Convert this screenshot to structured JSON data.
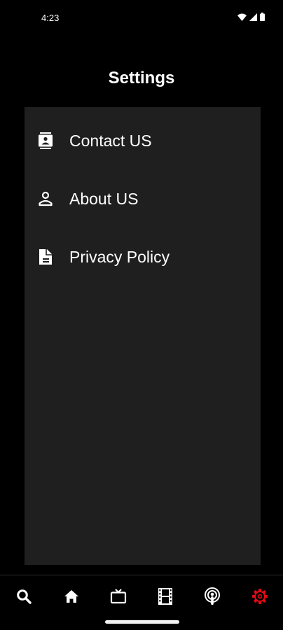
{
  "status_bar": {
    "time": "4:23",
    "icons": [
      "wifi-icon",
      "signal-icon",
      "battery-icon"
    ]
  },
  "header": {
    "title": "Settings"
  },
  "menu": {
    "items": [
      {
        "label": "Contact US",
        "icon": "contact-card-icon"
      },
      {
        "label": "About US",
        "icon": "person-icon"
      },
      {
        "label": "Privacy Policy",
        "icon": "document-icon"
      }
    ]
  },
  "bottom_nav": {
    "items": [
      {
        "icon": "search-icon",
        "active": false
      },
      {
        "icon": "home-icon",
        "active": false
      },
      {
        "icon": "tv-icon",
        "active": false
      },
      {
        "icon": "film-icon",
        "active": false
      },
      {
        "icon": "podcast-icon",
        "active": false
      },
      {
        "icon": "gear-icon",
        "active": true
      }
    ],
    "active_color": "#e50914",
    "inactive_color": "#ffffff"
  },
  "colors": {
    "background": "#000000",
    "panel": "#1f1f1f",
    "text": "#ffffff"
  }
}
